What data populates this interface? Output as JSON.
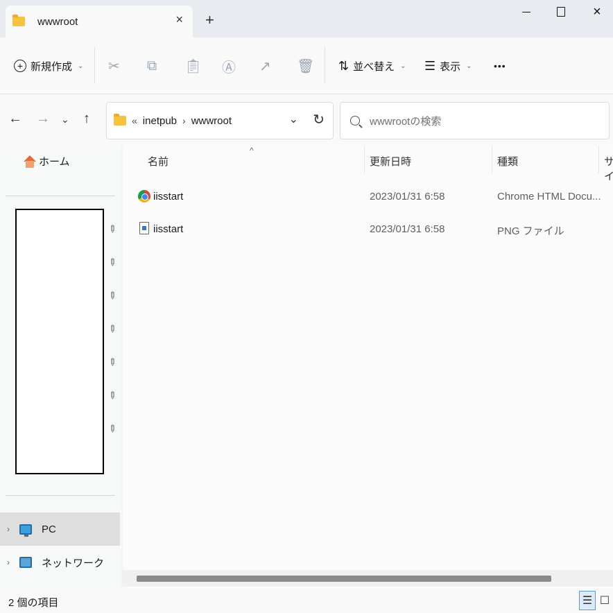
{
  "window": {
    "tab_title": "wwwroot",
    "tab_close": "×",
    "new_tab": "+",
    "close_glyph": "×"
  },
  "command_bar": {
    "new_label": "新規作成",
    "sort_label": "並べ替え",
    "view_label": "表示",
    "more": "•••",
    "chevron": "⌄"
  },
  "address": {
    "overflow": "«",
    "crumbs": [
      "inetpub",
      "wwwroot"
    ],
    "separator": "›",
    "dropdown": "⌄",
    "refresh": "↻"
  },
  "search": {
    "placeholder": "wwwrootの検索"
  },
  "nav": {
    "back": "←",
    "forward": "→",
    "recent": "⌄",
    "up": "↑"
  },
  "sidebar": {
    "home_label": "ホーム",
    "pc_label": "PC",
    "network_label": "ネットワーク",
    "expand": "›",
    "pin": "📌"
  },
  "columns": {
    "name": "名前",
    "date": "更新日時",
    "type": "種類",
    "size": "サイ",
    "sort_caret": "^"
  },
  "files": [
    {
      "name": "iisstart",
      "date": "2023/01/31 6:58",
      "type": "Chrome HTML Docu...",
      "icon": "chrome-html-icon"
    },
    {
      "name": "iisstart",
      "date": "2023/01/31 6:58",
      "type": "PNG ファイル",
      "icon": "png-file-icon"
    }
  ],
  "status": {
    "count": "2 個の項目",
    "details_view": "☰",
    "tiles_view": "☐"
  }
}
